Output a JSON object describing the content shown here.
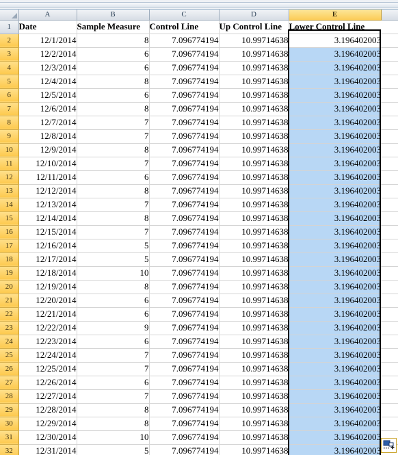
{
  "app": {
    "type": "spreadsheet",
    "active_cell": "E2",
    "selection_range": "E2:E32"
  },
  "colors": {
    "selection_fill": "#B8D7F5",
    "row_header_selected": "#FDC94E",
    "col_header_selected": "#FBCB57",
    "header_gray": "#D7DDE5",
    "grid_line": "#D4D4D4",
    "selection_border": "#000000",
    "smarttag_border": "#C9A227"
  },
  "columns": [
    {
      "letter": "A",
      "selected": false
    },
    {
      "letter": "B",
      "selected": false
    },
    {
      "letter": "C",
      "selected": false
    },
    {
      "letter": "D",
      "selected": false
    },
    {
      "letter": "E",
      "selected": true
    }
  ],
  "headers": {
    "a": "Date",
    "b": "Sample Measure",
    "c": "Control Line",
    "d": "Up Control Line",
    "e": "Lower Control Line"
  },
  "constants": {
    "control_line": "7.096774194",
    "up_control_line": "10.99714638",
    "lower_control_line": "3.196402003"
  },
  "smart_tag": {
    "name": "paste-options",
    "icon": "paste-options-icon",
    "label": "Paste Options"
  },
  "chart_data": {
    "type": "table",
    "title": "Control chart source data",
    "columns": [
      "Date",
      "Sample Measure",
      "Control Line",
      "Up Control Line",
      "Lower Control Line"
    ],
    "rows": [
      {
        "row": 2,
        "date": "12/1/2014",
        "sample": 8,
        "cl": "7.096774194",
        "ucl": "10.99714638",
        "lcl": "3.196402003"
      },
      {
        "row": 3,
        "date": "12/2/2014",
        "sample": 6,
        "cl": "7.096774194",
        "ucl": "10.99714638",
        "lcl": "3.196402003"
      },
      {
        "row": 4,
        "date": "12/3/2014",
        "sample": 6,
        "cl": "7.096774194",
        "ucl": "10.99714638",
        "lcl": "3.196402003"
      },
      {
        "row": 5,
        "date": "12/4/2014",
        "sample": 8,
        "cl": "7.096774194",
        "ucl": "10.99714638",
        "lcl": "3.196402003"
      },
      {
        "row": 6,
        "date": "12/5/2014",
        "sample": 6,
        "cl": "7.096774194",
        "ucl": "10.99714638",
        "lcl": "3.196402003"
      },
      {
        "row": 7,
        "date": "12/6/2014",
        "sample": 8,
        "cl": "7.096774194",
        "ucl": "10.99714638",
        "lcl": "3.196402003"
      },
      {
        "row": 8,
        "date": "12/7/2014",
        "sample": 7,
        "cl": "7.096774194",
        "ucl": "10.99714638",
        "lcl": "3.196402003"
      },
      {
        "row": 9,
        "date": "12/8/2014",
        "sample": 7,
        "cl": "7.096774194",
        "ucl": "10.99714638",
        "lcl": "3.196402003"
      },
      {
        "row": 10,
        "date": "12/9/2014",
        "sample": 8,
        "cl": "7.096774194",
        "ucl": "10.99714638",
        "lcl": "3.196402003"
      },
      {
        "row": 11,
        "date": "12/10/2014",
        "sample": 7,
        "cl": "7.096774194",
        "ucl": "10.99714638",
        "lcl": "3.196402003"
      },
      {
        "row": 12,
        "date": "12/11/2014",
        "sample": 6,
        "cl": "7.096774194",
        "ucl": "10.99714638",
        "lcl": "3.196402003"
      },
      {
        "row": 13,
        "date": "12/12/2014",
        "sample": 8,
        "cl": "7.096774194",
        "ucl": "10.99714638",
        "lcl": "3.196402003"
      },
      {
        "row": 14,
        "date": "12/13/2014",
        "sample": 7,
        "cl": "7.096774194",
        "ucl": "10.99714638",
        "lcl": "3.196402003"
      },
      {
        "row": 15,
        "date": "12/14/2014",
        "sample": 8,
        "cl": "7.096774194",
        "ucl": "10.99714638",
        "lcl": "3.196402003"
      },
      {
        "row": 16,
        "date": "12/15/2014",
        "sample": 7,
        "cl": "7.096774194",
        "ucl": "10.99714638",
        "lcl": "3.196402003"
      },
      {
        "row": 17,
        "date": "12/16/2014",
        "sample": 5,
        "cl": "7.096774194",
        "ucl": "10.99714638",
        "lcl": "3.196402003"
      },
      {
        "row": 18,
        "date": "12/17/2014",
        "sample": 5,
        "cl": "7.096774194",
        "ucl": "10.99714638",
        "lcl": "3.196402003"
      },
      {
        "row": 19,
        "date": "12/18/2014",
        "sample": 10,
        "cl": "7.096774194",
        "ucl": "10.99714638",
        "lcl": "3.196402003"
      },
      {
        "row": 20,
        "date": "12/19/2014",
        "sample": 8,
        "cl": "7.096774194",
        "ucl": "10.99714638",
        "lcl": "3.196402003"
      },
      {
        "row": 21,
        "date": "12/20/2014",
        "sample": 6,
        "cl": "7.096774194",
        "ucl": "10.99714638",
        "lcl": "3.196402003"
      },
      {
        "row": 22,
        "date": "12/21/2014",
        "sample": 6,
        "cl": "7.096774194",
        "ucl": "10.99714638",
        "lcl": "3.196402003"
      },
      {
        "row": 23,
        "date": "12/22/2014",
        "sample": 9,
        "cl": "7.096774194",
        "ucl": "10.99714638",
        "lcl": "3.196402003"
      },
      {
        "row": 24,
        "date": "12/23/2014",
        "sample": 6,
        "cl": "7.096774194",
        "ucl": "10.99714638",
        "lcl": "3.196402003"
      },
      {
        "row": 25,
        "date": "12/24/2014",
        "sample": 7,
        "cl": "7.096774194",
        "ucl": "10.99714638",
        "lcl": "3.196402003"
      },
      {
        "row": 26,
        "date": "12/25/2014",
        "sample": 7,
        "cl": "7.096774194",
        "ucl": "10.99714638",
        "lcl": "3.196402003"
      },
      {
        "row": 27,
        "date": "12/26/2014",
        "sample": 6,
        "cl": "7.096774194",
        "ucl": "10.99714638",
        "lcl": "3.196402003"
      },
      {
        "row": 28,
        "date": "12/27/2014",
        "sample": 7,
        "cl": "7.096774194",
        "ucl": "10.99714638",
        "lcl": "3.196402003"
      },
      {
        "row": 29,
        "date": "12/28/2014",
        "sample": 8,
        "cl": "7.096774194",
        "ucl": "10.99714638",
        "lcl": "3.196402003"
      },
      {
        "row": 30,
        "date": "12/29/2014",
        "sample": 8,
        "cl": "7.096774194",
        "ucl": "10.99714638",
        "lcl": "3.196402003"
      },
      {
        "row": 31,
        "date": "12/30/2014",
        "sample": 10,
        "cl": "7.096774194",
        "ucl": "10.99714638",
        "lcl": "3.196402003"
      },
      {
        "row": 32,
        "date": "12/31/2014",
        "sample": 5,
        "cl": "7.096774194",
        "ucl": "10.99714638",
        "lcl": "3.196402003"
      }
    ]
  }
}
